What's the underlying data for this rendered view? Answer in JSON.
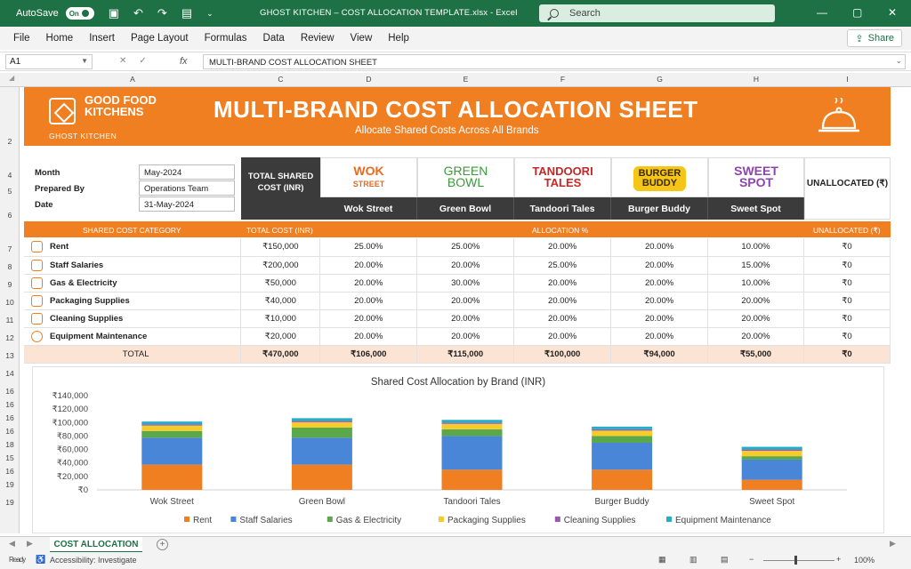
{
  "titlebar": {
    "autosave_label": "AutoSave",
    "autosave_state": "On",
    "filename": "GHOST KITCHEN – COST ALLOCATION TEMPLATE.xlsx - Excel",
    "search_placeholder": "Search"
  },
  "menu": [
    "File",
    "Home",
    "Insert",
    "Page Layout",
    "Formulas",
    "Data",
    "Review",
    "View",
    "Help"
  ],
  "share_label": "Share",
  "formula_bar": {
    "cell_ref": "A1",
    "fx": "fx",
    "value": "MULTI-BRAND COST ALLOCATION SHEET"
  },
  "columns": [
    "A",
    "C",
    "D",
    "E",
    "F",
    "G",
    "H",
    "I"
  ],
  "rows": [
    "2",
    "4",
    "5",
    "6",
    "7",
    "8",
    "9",
    "10",
    "11",
    "12",
    "13",
    "14",
    "16",
    "16",
    "16",
    "16",
    "18",
    "15",
    "16",
    "19",
    "19"
  ],
  "banner": {
    "logo_text": "GOOD FOOD KITCHENS",
    "logo_sub": "GHOST KITCHEN",
    "title": "MULTI-BRAND COST ALLOCATION SHEET",
    "subtitle": "Allocate Shared Costs Across All Brands"
  },
  "info": {
    "month_label": "Month",
    "month_value": "May-2024",
    "prepared_label": "Prepared By",
    "prepared_value": "Operations Team",
    "date_label": "Date",
    "date_value": "31-May-2024"
  },
  "total_header": "TOTAL SHARED COST (INR)",
  "unallocated_header": "UNALLOCATED (₹)",
  "brands": [
    {
      "logo_line1": "WOK",
      "logo_line2": "STREET",
      "name": "Wok Street",
      "color": "#e86a1f"
    },
    {
      "logo_line1": "GREEN",
      "logo_line2": "BOWL",
      "name": "Green Bowl",
      "color": "#3a9a3a"
    },
    {
      "logo_line1": "TANDOORI",
      "logo_line2": "TALES",
      "name": "Tandoori Tales",
      "color": "#c62828"
    },
    {
      "logo_line1": "BURGER",
      "logo_line2": "BUDDY",
      "name": "Burger Buddy",
      "color": "#3b2a00"
    },
    {
      "logo_line1": "SWEET",
      "logo_line2": "SPOT",
      "name": "Sweet Spot",
      "color": "#8e44ad"
    }
  ],
  "subheader": {
    "category": "SHARED COST CATEGORY",
    "total": "TOTAL COST (INR)",
    "allocation": "ALLOCATION %",
    "unallocated": "UNALLOCATED (₹)"
  },
  "cost_rows": [
    {
      "category": "Rent",
      "icon": "building-icon",
      "total": "₹150,000",
      "alloc": [
        "25.00%",
        "25.00%",
        "20.00%",
        "20.00%",
        "10.00%"
      ],
      "unallocated": "₹0"
    },
    {
      "category": "Staff Salaries",
      "icon": "people-icon",
      "total": "₹200,000",
      "alloc": [
        "20.00%",
        "20.00%",
        "25.00%",
        "20.00%",
        "15.00%"
      ],
      "unallocated": "₹0"
    },
    {
      "category": "Gas & Electricity",
      "icon": "flame-icon",
      "total": "₹50,000",
      "alloc": [
        "20.00%",
        "30.00%",
        "20.00%",
        "20.00%",
        "10.00%"
      ],
      "unallocated": "₹0"
    },
    {
      "category": "Packaging Supplies",
      "icon": "box-icon",
      "total": "₹40,000",
      "alloc": [
        "20.00%",
        "20.00%",
        "20.00%",
        "20.00%",
        "20.00%"
      ],
      "unallocated": "₹0"
    },
    {
      "category": "Cleaning Supplies",
      "icon": "spray-icon",
      "total": "₹10,000",
      "alloc": [
        "20.00%",
        "20.00%",
        "20.00%",
        "20.00%",
        "20.00%"
      ],
      "unallocated": "₹0"
    },
    {
      "category": "Equipment Maintenance",
      "icon": "gear-icon",
      "total": "₹20,000",
      "alloc": [
        "20.00%",
        "20.00%",
        "20.00%",
        "20.00%",
        "20.00%"
      ],
      "unallocated": "₹0"
    }
  ],
  "total_row": {
    "label": "TOTAL",
    "total": "₹470,000",
    "brand_totals": [
      "₹106,000",
      "₹115,000",
      "₹100,000",
      "₹94,000",
      "₹55,000"
    ],
    "unallocated": "₹0"
  },
  "chart_data": {
    "type": "bar",
    "stacked": true,
    "title": "Shared Cost Allocation by Brand (INR)",
    "categories": [
      "Wok Street",
      "Green Bowl",
      "Tandoori Tales",
      "Burger Buddy",
      "Sweet Spot"
    ],
    "yticks": [
      "₹140,000",
      "₹120,000",
      "₹100,000",
      "₹80,000",
      "₹60,000",
      "₹40,000",
      "₹20,000",
      "₹0"
    ],
    "ylim": [
      0,
      140000
    ],
    "legend_position": "bottom",
    "series": [
      {
        "name": "Rent",
        "color": "#f07f22",
        "values": [
          37500,
          37500,
          30000,
          30000,
          15000
        ]
      },
      {
        "name": "Staff Salaries",
        "color": "#4a86d8",
        "values": [
          40000,
          40000,
          50000,
          40000,
          30000
        ]
      },
      {
        "name": "Gas & Electricity",
        "color": "#5aa84a",
        "values": [
          10000,
          15000,
          10000,
          10000,
          5000
        ]
      },
      {
        "name": "Packaging Supplies",
        "color": "#f5cc2a",
        "values": [
          8000,
          8000,
          8000,
          8000,
          8000
        ]
      },
      {
        "name": "Cleaning Supplies",
        "color": "#9b59b6",
        "values": [
          2000,
          2000,
          2000,
          2000,
          2000
        ]
      },
      {
        "name": "Equipment Maintenance",
        "color": "#22b0c4",
        "values": [
          4000,
          4000,
          4000,
          4000,
          4000
        ]
      }
    ]
  },
  "sheet_tab": "COST ALLOCATION",
  "status": {
    "accessibility": "Accessibility: Investigate",
    "zoom": "100%"
  }
}
